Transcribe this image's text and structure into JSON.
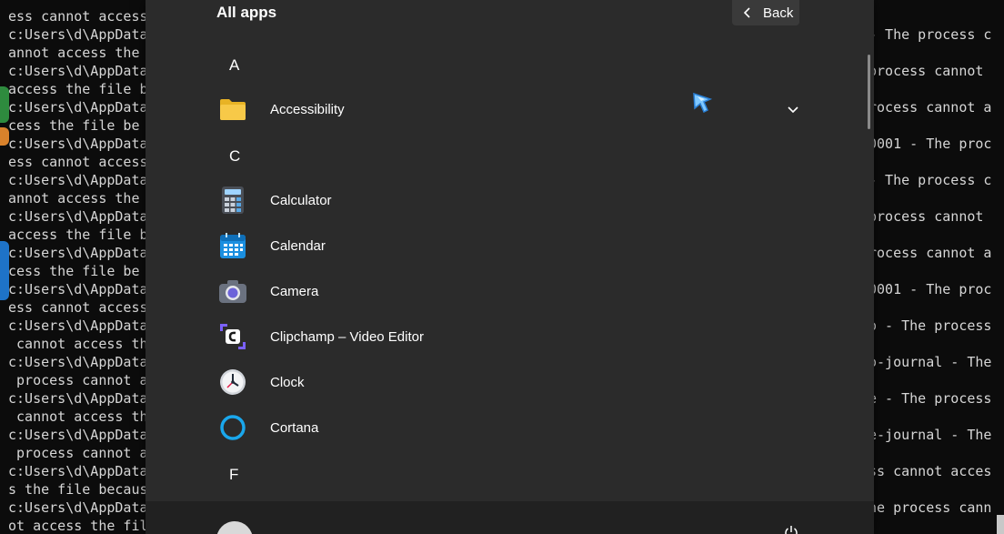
{
  "terminal": {
    "left_lines": [
      "ess cannot access",
      "c:Users\\d\\AppData",
      "annot access the",
      "c:Users\\d\\AppData",
      "access the file b",
      "c:Users\\d\\AppData",
      "cess the file be",
      "c:Users\\d\\AppData",
      "ess cannot access",
      "c:Users\\d\\AppData",
      "annot access the",
      "c:Users\\d\\AppData",
      "access the file b",
      "c:Users\\d\\AppData",
      "cess the file be",
      "c:Users\\d\\AppData",
      "ess cannot access",
      "c:Users\\d\\AppData",
      " cannot access th",
      "c:Users\\d\\AppData",
      " process cannot a",
      "c:Users\\d\\AppData",
      " cannot access th",
      "c:Users\\d\\AppData",
      " process cannot a",
      "c:Users\\d\\AppData",
      "s the file becaus",
      "c:Users\\d\\AppData",
      "ot access the fil"
    ],
    "right_lines": [
      "- The process c",
      "",
      "process cannot",
      "",
      "rocess cannot a",
      "",
      "0001 - The proc",
      "",
      "- The process c",
      "",
      "process cannot",
      "",
      "rocess cannot a",
      "",
      "0001 - The proc",
      "",
      "o - The process",
      "",
      "o-journal - The",
      "",
      "e - The process",
      "",
      "e-journal - The",
      "",
      "ss cannot acces",
      "",
      "he process cann"
    ]
  },
  "start_menu": {
    "title": "All apps",
    "back_label": "Back",
    "groups": [
      {
        "letter": "A"
      },
      {
        "letter": "C"
      },
      {
        "letter": "F"
      }
    ],
    "apps": [
      {
        "label": "Accessibility",
        "icon": "folder-icon"
      },
      {
        "label": "Calculator",
        "icon": "calculator-icon"
      },
      {
        "label": "Calendar",
        "icon": "calendar-icon"
      },
      {
        "label": "Camera",
        "icon": "camera-icon"
      },
      {
        "label": "Clipchamp – Video Editor",
        "icon": "clipchamp-icon"
      },
      {
        "label": "Clock",
        "icon": "clock-icon"
      },
      {
        "label": "Cortana",
        "icon": "cortana-icon"
      }
    ]
  },
  "colors": {
    "panel_bg": "#2b2b2b",
    "footer_bg": "#212121",
    "accent": "#0078d4",
    "folder": "#f4c430"
  }
}
